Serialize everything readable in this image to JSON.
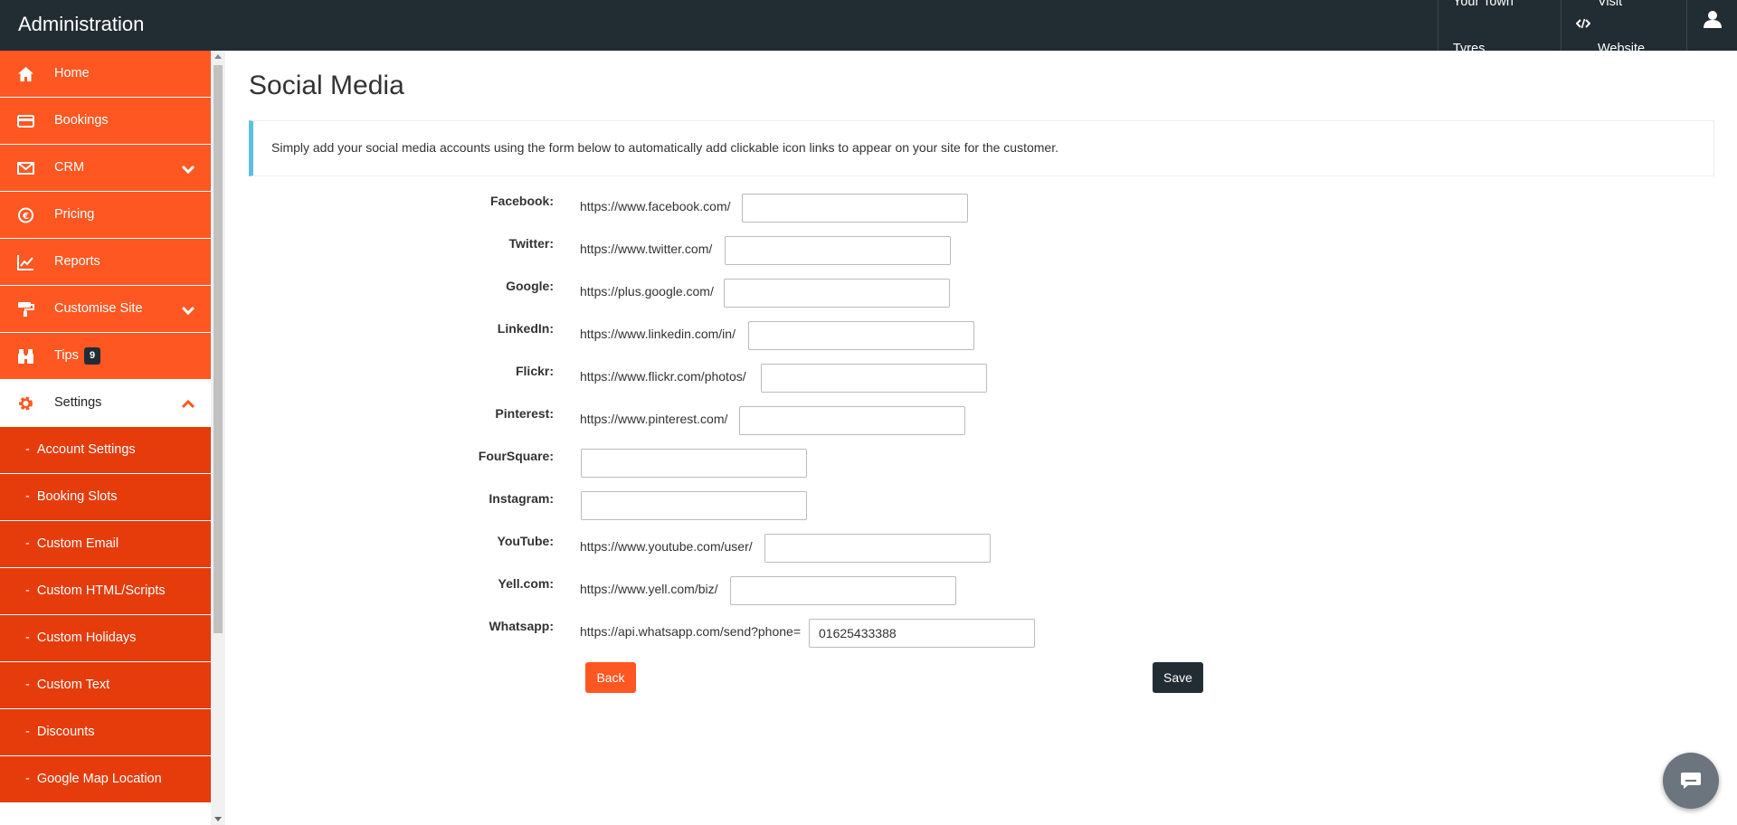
{
  "app": {
    "title": "Administration"
  },
  "topnav": {
    "shop_name": "Your Town Tyres",
    "visit_label": "Visit Website",
    "user_icon": "user-icon"
  },
  "sidebar": {
    "items": [
      {
        "label": "Home",
        "icon": "home-icon"
      },
      {
        "label": "Bookings",
        "icon": "credit-card-icon"
      },
      {
        "label": "CRM",
        "icon": "envelope-icon",
        "expandable": true
      },
      {
        "label": "Pricing",
        "icon": "euro-icon"
      },
      {
        "label": "Reports",
        "icon": "chart-line-icon"
      },
      {
        "label": "Customise Site",
        "icon": "paint-roller-icon",
        "expandable": true
      },
      {
        "label": "Tips",
        "icon": "binoculars-icon",
        "badge": "9"
      },
      {
        "label": "Settings",
        "icon": "gear-icon",
        "expanded": true
      }
    ],
    "sub_items": [
      "Account Settings",
      "Booking Slots",
      "Custom Email",
      "Custom HTML/Scripts",
      "Custom Holidays",
      "Custom Text",
      "Discounts",
      "Google Map Location"
    ],
    "dash": "-"
  },
  "page": {
    "title": "Social Media",
    "info": "Simply add your social media accounts using the form below to automatically add clickable icon links to appear on your site for the customer."
  },
  "form": {
    "fields": [
      {
        "label": "Facebook:",
        "prefix": "https://www.facebook.com/",
        "value": ""
      },
      {
        "label": "Twitter:",
        "prefix": "https://www.twitter.com/",
        "value": ""
      },
      {
        "label": "Google:",
        "prefix": "https://plus.google.com/",
        "value": ""
      },
      {
        "label": "LinkedIn:",
        "prefix": "https://www.linkedin.com/in/",
        "value": ""
      },
      {
        "label": "Flickr:",
        "prefix": "https://www.flickr.com/photos/",
        "value": ""
      },
      {
        "label": "Pinterest:",
        "prefix": "https://www.pinterest.com/",
        "value": ""
      },
      {
        "label": "FourSquare:",
        "prefix": "",
        "value": ""
      },
      {
        "label": "Instagram:",
        "prefix": "",
        "value": ""
      },
      {
        "label": "YouTube:",
        "prefix": "https://www.youtube.com/user/",
        "value": ""
      },
      {
        "label": "Yell.com:",
        "prefix": "https://www.yell.com/biz/",
        "value": ""
      },
      {
        "label": "Whatsapp:",
        "prefix": "https://api.whatsapp.com/send?phone=",
        "value": "01625433388"
      }
    ],
    "back_label": "Back",
    "save_label": "Save"
  },
  "colors": {
    "topbar": "#222d33",
    "sidebar_item": "#ff5722",
    "sidebar_subitem": "#e63c0c",
    "info_border": "#5bc0de"
  }
}
